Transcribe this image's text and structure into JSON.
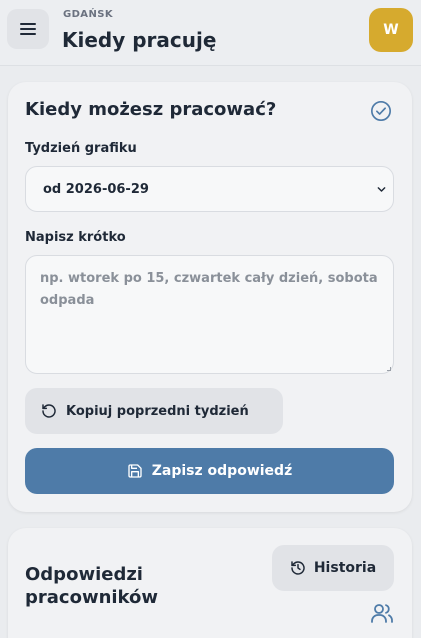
{
  "header": {
    "city": "GDAŃSK",
    "title": "Kiedy pracuję",
    "avatar_initial": "W",
    "avatar_color": "#d6aa2e"
  },
  "availability_form": {
    "title": "Kiedy możesz pracować?",
    "week_label": "Tydzień grafiku",
    "week_selected": "od 2026-06-29",
    "note_label": "Napisz krótko",
    "note_placeholder": "np. wtorek po 15, czwartek cały dzień, sobota odpada",
    "note_value": "",
    "copy_button_label": "Kopiuj poprzedni tydzień",
    "save_button_label": "Zapisz odpowiedź"
  },
  "responses": {
    "title": "Odpowiedzi pracowników",
    "history_button_label": "Historia"
  },
  "colors": {
    "accent": "#4e7ba8",
    "avatar": "#d6aa2e"
  },
  "icons": {
    "menu": "menu-icon",
    "check": "check-circle-icon",
    "dropdown": "chevron-down-icon",
    "copy": "rotate-ccw-icon",
    "save": "save-icon",
    "history": "history-icon",
    "users": "users-icon"
  }
}
